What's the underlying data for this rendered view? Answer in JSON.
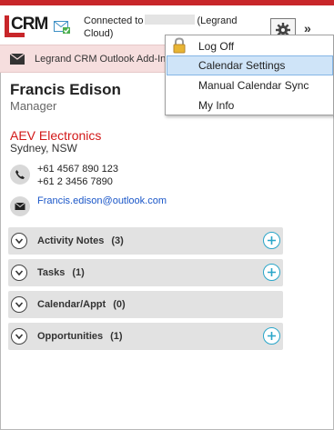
{
  "header": {
    "logo_text": "CRM",
    "connection_prefix": "Connected to",
    "connection_suffix": "(Legrand",
    "connection_line2": "Cloud)",
    "more_label": "»"
  },
  "addin_bar": {
    "label": "Legrand CRM Outlook Add-In"
  },
  "contact": {
    "name": "Francis Edison",
    "title": "Manager",
    "company": "AEV Electronics",
    "location": "Sydney, NSW",
    "phone1": "+61 4567 890 123",
    "phone2": "+61 2 3456 7890",
    "email": "Francis.edison@outlook.com"
  },
  "sections": [
    {
      "label": "Activity Notes",
      "count": "(3)",
      "has_add": true
    },
    {
      "label": "Tasks",
      "count": "(1)",
      "has_add": true
    },
    {
      "label": "Calendar/Appt",
      "count": "(0)",
      "has_add": false
    },
    {
      "label": "Opportunities",
      "count": "(1)",
      "has_add": true
    }
  ],
  "menu": {
    "items": [
      {
        "label": "Log Off",
        "icon": "lock-icon"
      },
      {
        "label": "Calendar Settings",
        "highlighted": true
      },
      {
        "label": "Manual Calendar Sync"
      },
      {
        "label": "My Info"
      }
    ]
  },
  "colors": {
    "brand_red": "#c8262a",
    "company_red": "#d21818",
    "link_blue": "#1a56c8",
    "add_teal": "#2aa6c9",
    "menu_highlight": "#cfe4f8"
  }
}
